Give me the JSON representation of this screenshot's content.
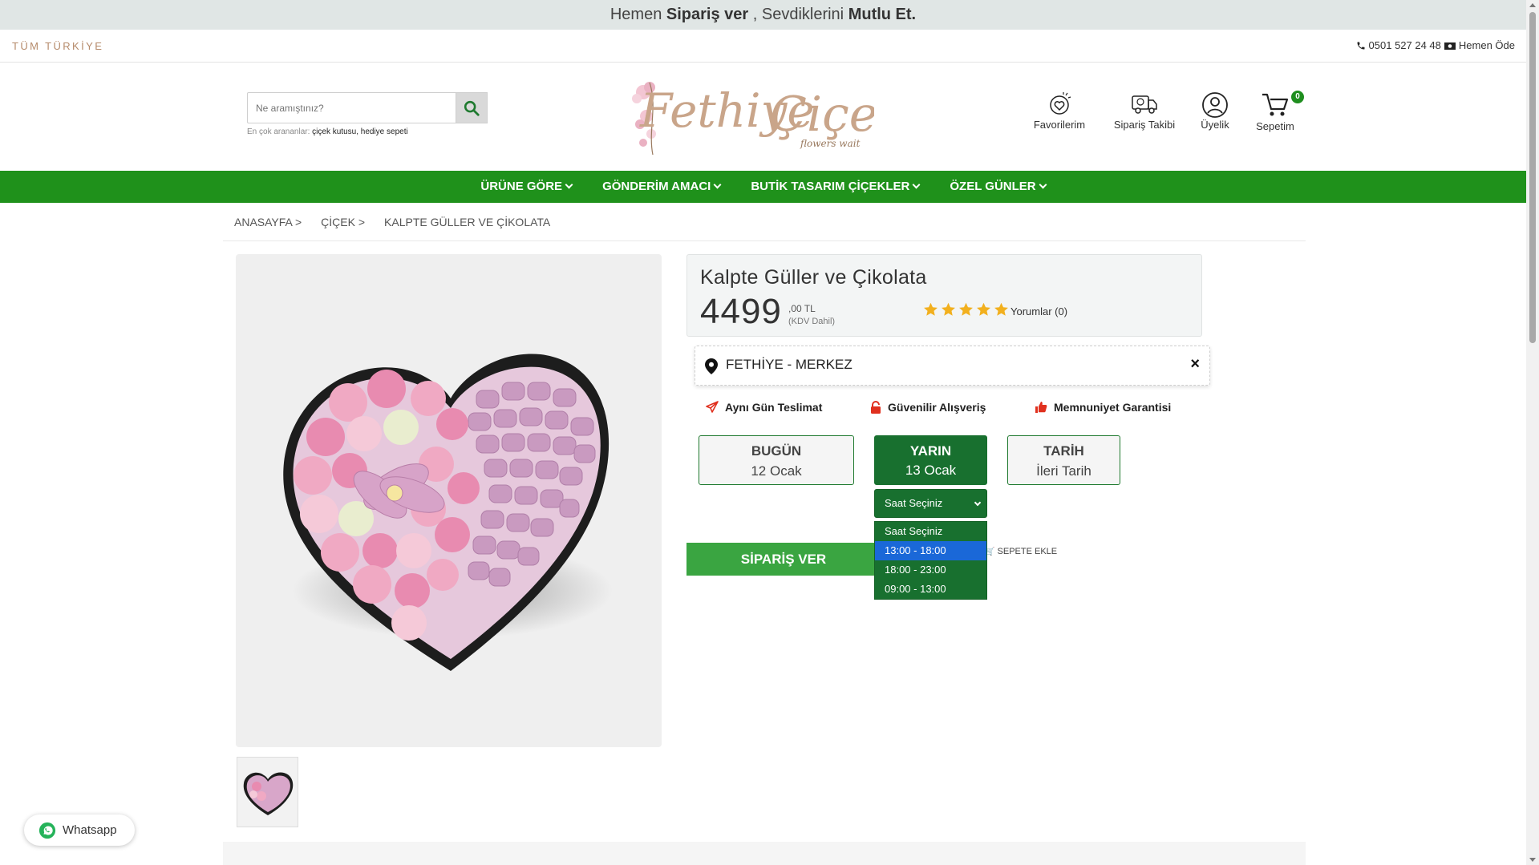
{
  "banner": {
    "p1": "Hemen ",
    "b1": "Sipariş ver",
    "p2": " , Sevdiklerini ",
    "b2": "Mutlu Et."
  },
  "strip": {
    "region": "TÜM TÜRKİYE",
    "phone": "0501 527 24 48",
    "pay": "Hemen Öde"
  },
  "search": {
    "placeholder": "Ne aramıştınız?",
    "popular_label": "En çok arananlar:",
    "popular_1": "çiçek kutusu",
    "popular_sep": ", ",
    "popular_2": "hediye sepeti"
  },
  "logo": {
    "text1": "Fethiye",
    "text2": "Çiçek",
    "tagline": "flowers wait"
  },
  "header_icons": {
    "favorites": "Favorilerim",
    "tracking": "Sipariş Takibi",
    "account": "Üyelik",
    "cart": "Sepetim",
    "cart_count": "0"
  },
  "nav": [
    "ÜRÜNE GÖRE",
    "GÖNDERİM AMACI",
    "BUTİK TASARIM ÇİÇEKLER",
    "ÖZEL GÜNLER"
  ],
  "breadcrumb": [
    "ANASAYFA >",
    "ÇİÇEK >",
    "KALPTE GÜLLER VE ÇİKOLATA"
  ],
  "product": {
    "title": "Kalpte Güller ve Çikolata",
    "price": "4499",
    "cents": ",00 TL",
    "kdv": "(KDV Dahil)",
    "rating": 5,
    "reviews": "Yorumlar (0)"
  },
  "location": {
    "text": "FETHİYE - MERKEZ",
    "close": "×"
  },
  "features": [
    "Aynı Gün Teslimat",
    "Güvenilir Alışveriş",
    "Memnuniyet Garantisi"
  ],
  "dates": [
    {
      "title": "BUGÜN",
      "sub": "12 Ocak"
    },
    {
      "title": "YARIN",
      "sub": "13 Ocak"
    },
    {
      "title": "TARİH",
      "sub": "İleri Tarih"
    }
  ],
  "time_select": {
    "value": "Saat Seçiniz",
    "options": [
      "Saat Seçiniz",
      "13:00 - 18:00",
      "18:00 - 23:00",
      "09:00 - 13:00"
    ],
    "highlighted_index": 1
  },
  "buy_label": "SİPARİŞ VER",
  "add_cart_label": "SEPETE EKLE",
  "whatsapp_label": "Whatsapp",
  "colors": {
    "nav_green": "#1f911b",
    "dark_green": "#18702f",
    "buy_green": "#3aa541",
    "star": "#f2b01e",
    "highlight_blue": "#1a68d8"
  }
}
